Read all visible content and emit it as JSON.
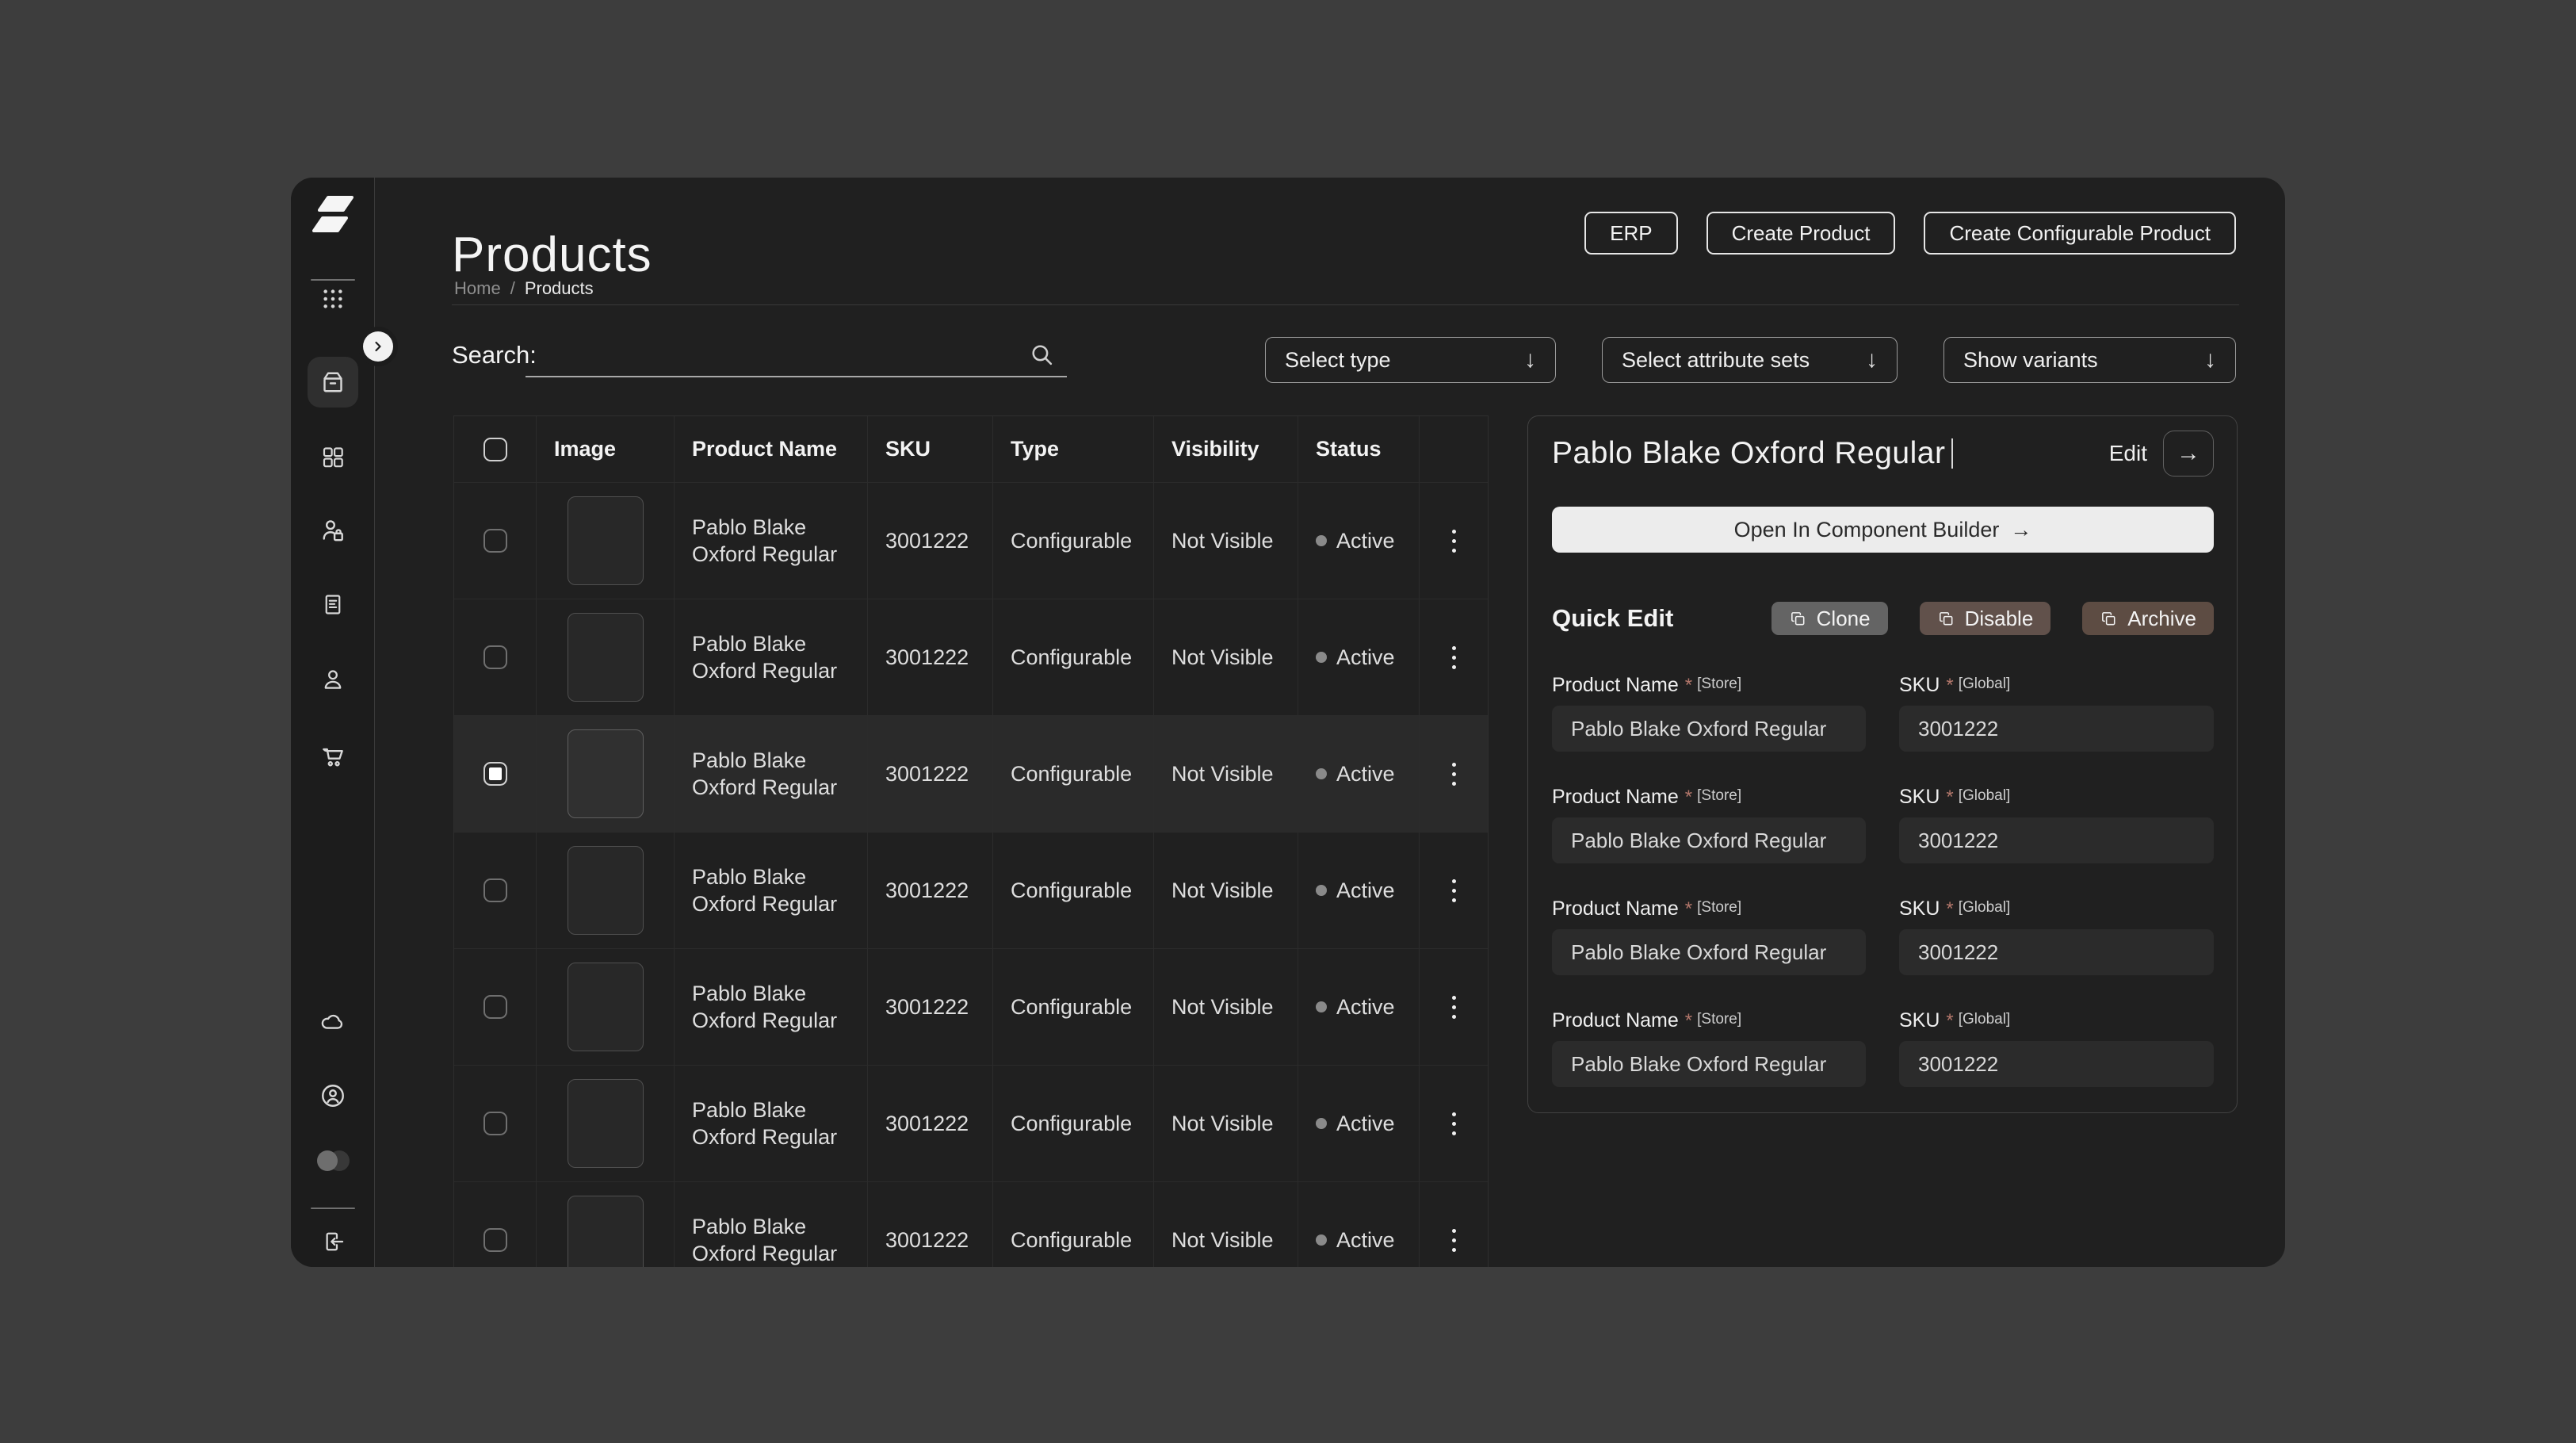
{
  "colors": {
    "background": "#3d3d3d",
    "window": "#202020",
    "sidebar": "#1c1c1c",
    "table_border": "#2e2e2e",
    "panel_border": "#424242",
    "selected_row": "#2a2a2a",
    "light_button": "#ececec",
    "status_dot": "#8a8a8a",
    "action_clone": "#646464",
    "action_disable": "#61514b",
    "action_archive": "#5d4c43"
  },
  "sidebar": {
    "logo_icon": "s-mark-logo",
    "expand_icon": "chevron-right-icon",
    "nav_icons": [
      "apps-grid-icon",
      "package-icon (active)",
      "dashboard-icon",
      "customers-icon",
      "orders-doc-icon",
      "profile-icon",
      "cart-icon"
    ],
    "footer_icons": [
      "cloud-icon",
      "account-icon",
      "theme-toggle-icon",
      "logout-icon"
    ]
  },
  "header": {
    "title": "Products",
    "buttons": [
      {
        "label": "ERP"
      },
      {
        "label": "Create Product"
      },
      {
        "label": "Create Configurable Product"
      }
    ]
  },
  "breadcrumb": {
    "home": "Home",
    "separator": "/",
    "current": "Products"
  },
  "toolbar": {
    "search_label": "Search:",
    "search_value": "",
    "dropdown_arrow": "↓",
    "dropdowns": [
      {
        "label": "Select type"
      },
      {
        "label": "Select attribute sets"
      },
      {
        "label": "Show variants"
      }
    ]
  },
  "table": {
    "columns": {
      "image": "Image",
      "product_name": "Product Name",
      "sku": "SKU",
      "type": "Type",
      "visibility": "Visibility",
      "status": "Status"
    },
    "rows": [
      {
        "product_name": "Pablo Blake Oxford Regular",
        "sku": "3001222",
        "type": "Configurable",
        "visibility": "Not Visible",
        "status": "Active",
        "selected": false
      },
      {
        "product_name": "Pablo Blake Oxford Regular",
        "sku": "3001222",
        "type": "Configurable",
        "visibility": "Not Visible",
        "status": "Active",
        "selected": false
      },
      {
        "product_name": "Pablo Blake Oxford Regular",
        "sku": "3001222",
        "type": "Configurable",
        "visibility": "Not Visible",
        "status": "Active",
        "selected": true
      },
      {
        "product_name": "Pablo Blake Oxford Regular",
        "sku": "3001222",
        "type": "Configurable",
        "visibility": "Not Visible",
        "status": "Active",
        "selected": false
      },
      {
        "product_name": "Pablo Blake Oxford Regular",
        "sku": "3001222",
        "type": "Configurable",
        "visibility": "Not Visible",
        "status": "Active",
        "selected": false
      },
      {
        "product_name": "Pablo Blake Oxford Regular",
        "sku": "3001222",
        "type": "Configurable",
        "visibility": "Not Visible",
        "status": "Active",
        "selected": false
      },
      {
        "product_name": "Pablo Blake Oxford Regular",
        "sku": "3001222",
        "type": "Configurable",
        "visibility": "Not Visible",
        "status": "Active",
        "selected": false
      }
    ]
  },
  "panel": {
    "title": "Pablo Blake Oxford Regular",
    "edit_label": "Edit",
    "edit_arrow": "→",
    "open_builder_label": "Open In Component Builder",
    "open_builder_arrow": "→",
    "quick_edit_title": "Quick Edit",
    "actions": [
      {
        "label": "Clone",
        "icon": "copy-icon"
      },
      {
        "label": "Disable",
        "icon": "copy-icon"
      },
      {
        "label": "Archive",
        "icon": "copy-icon"
      }
    ],
    "fields": [
      {
        "name_label": "Product Name",
        "name_required": "*",
        "name_scope": "[Store]",
        "name_value": "Pablo Blake Oxford Regular",
        "sku_label": "SKU",
        "sku_required": "*",
        "sku_scope": "[Global]",
        "sku_value": "3001222"
      },
      {
        "name_label": "Product Name",
        "name_required": "*",
        "name_scope": "[Store]",
        "name_value": "Pablo Blake Oxford Regular",
        "sku_label": "SKU",
        "sku_required": "*",
        "sku_scope": "[Global]",
        "sku_value": "3001222"
      },
      {
        "name_label": "Product Name",
        "name_required": "*",
        "name_scope": "[Store]",
        "name_value": "Pablo Blake Oxford Regular",
        "sku_label": "SKU",
        "sku_required": "*",
        "sku_scope": "[Global]",
        "sku_value": "3001222"
      },
      {
        "name_label": "Product Name",
        "name_required": "*",
        "name_scope": "[Store]",
        "name_value": "Pablo Blake Oxford Regular",
        "sku_label": "SKU",
        "sku_required": "*",
        "sku_scope": "[Global]",
        "sku_value": "3001222"
      }
    ]
  }
}
